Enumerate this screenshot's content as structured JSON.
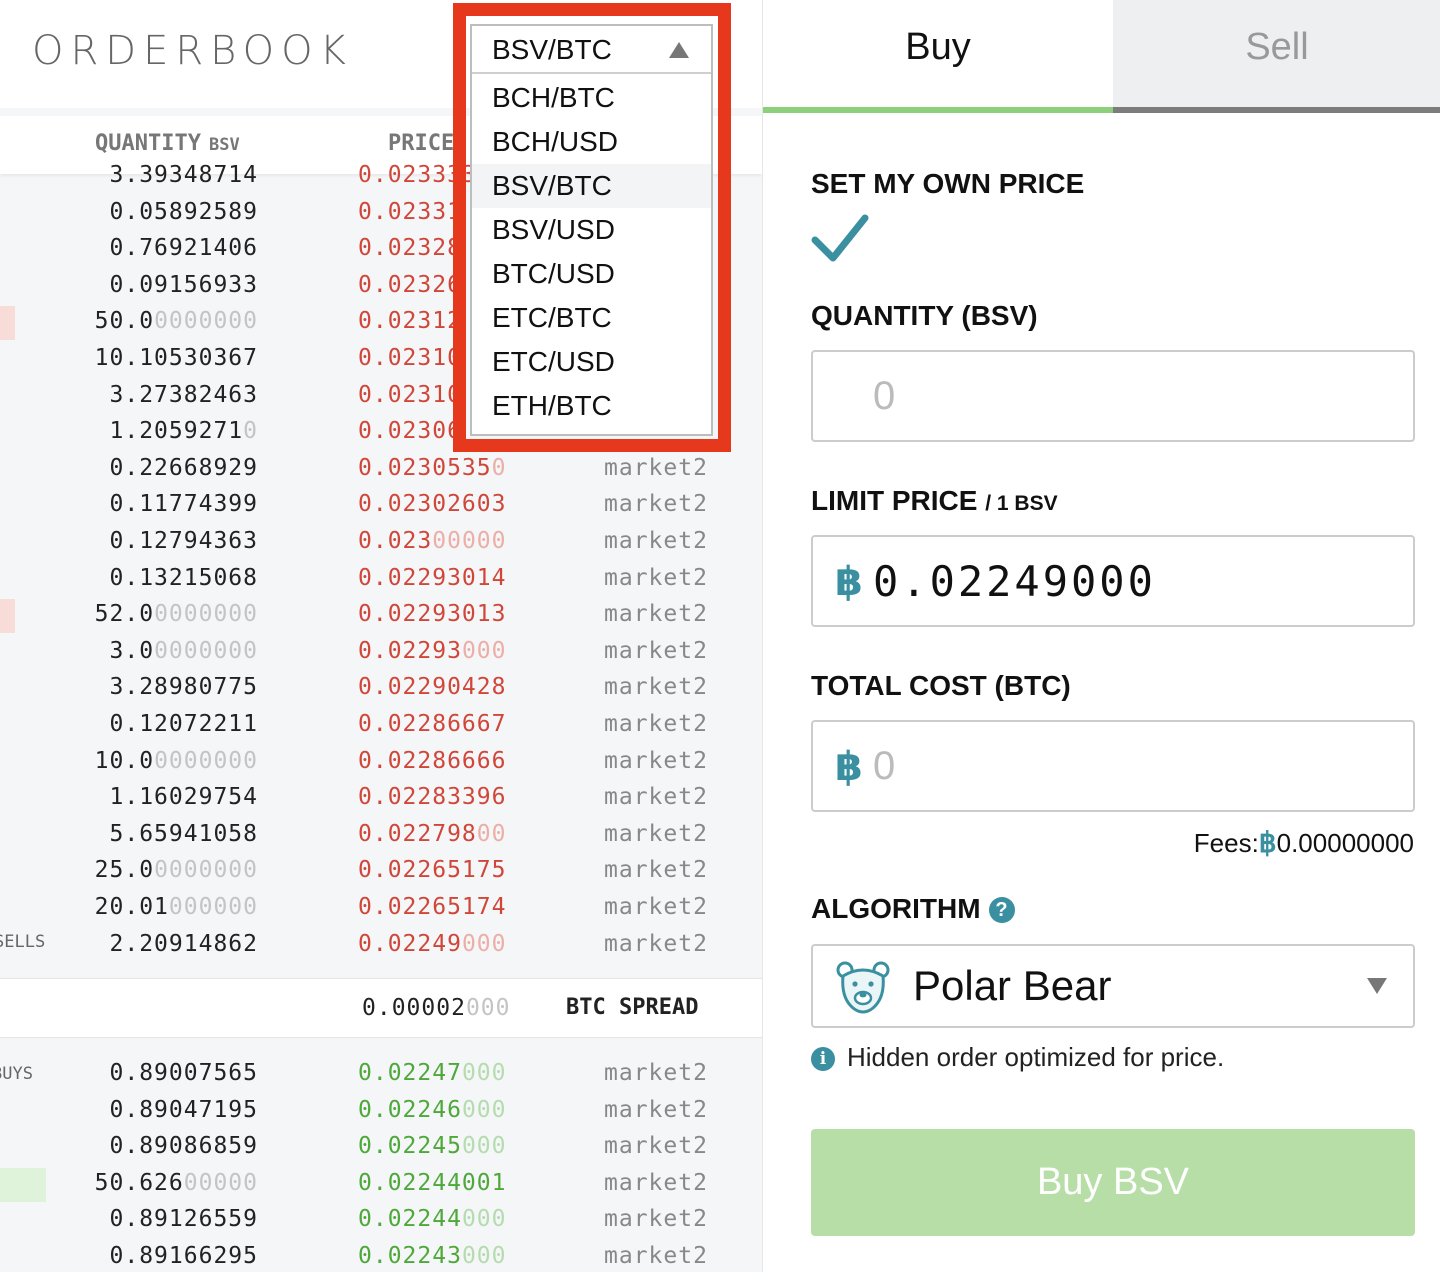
{
  "orderbook": {
    "title": "ORDERBOOK",
    "columns": {
      "quantity": "QUANTITY",
      "quantity_unit": "BSV",
      "price": "PRICE"
    },
    "sells_label": "SELLS",
    "buys_label": "BUYS",
    "sells": [
      {
        "qty_main": "3.39348714",
        "qty_dim": "",
        "price_main": "0.023333",
        "price_dim": "",
        "market": "",
        "depth": 0
      },
      {
        "qty_main": "0.05892589",
        "qty_dim": "",
        "price_main": "0.02331",
        "price_dim": "",
        "market": "",
        "depth": 0
      },
      {
        "qty_main": "0.76921406",
        "qty_dim": "",
        "price_main": "0.02328",
        "price_dim": "",
        "market": "",
        "depth": 0
      },
      {
        "qty_main": "0.09156933",
        "qty_dim": "",
        "price_main": "0.02326",
        "price_dim": "",
        "market": "",
        "depth": 0
      },
      {
        "qty_main": "50.0",
        "qty_dim": "0000000",
        "price_main": "0.02312",
        "price_dim": "",
        "market": "",
        "depth": 0.02
      },
      {
        "qty_main": "10.10530367",
        "qty_dim": "",
        "price_main": "0.02310",
        "price_dim": "",
        "market": "",
        "depth": 0
      },
      {
        "qty_main": "3.27382463",
        "qty_dim": "",
        "price_main": "0.02310",
        "price_dim": "",
        "market": "",
        "depth": 0
      },
      {
        "qty_main": "1.2059271",
        "qty_dim": "0",
        "price_main": "0.02306",
        "price_dim": "",
        "market": "",
        "depth": 0
      },
      {
        "qty_main": "0.22668929",
        "qty_dim": "",
        "price_main": "0.0230535",
        "price_dim": "0",
        "market": "market2",
        "depth": 0
      },
      {
        "qty_main": "0.11774399",
        "qty_dim": "",
        "price_main": "0.02302603",
        "price_dim": "",
        "market": "market2",
        "depth": 0
      },
      {
        "qty_main": "0.12794363",
        "qty_dim": "",
        "price_main": "0.023",
        "price_dim": "00000",
        "market": "market2",
        "depth": 0
      },
      {
        "qty_main": "0.13215068",
        "qty_dim": "",
        "price_main": "0.02293014",
        "price_dim": "",
        "market": "market2",
        "depth": 0
      },
      {
        "qty_main": "52.0",
        "qty_dim": "0000000",
        "price_main": "0.02293013",
        "price_dim": "",
        "market": "market2",
        "depth": 0.02
      },
      {
        "qty_main": "3.0",
        "qty_dim": "0000000",
        "price_main": "0.02293",
        "price_dim": "000",
        "market": "market2",
        "depth": 0
      },
      {
        "qty_main": "3.28980775",
        "qty_dim": "",
        "price_main": "0.02290428",
        "price_dim": "",
        "market": "market2",
        "depth": 0
      },
      {
        "qty_main": "0.12072211",
        "qty_dim": "",
        "price_main": "0.02286667",
        "price_dim": "",
        "market": "market2",
        "depth": 0
      },
      {
        "qty_main": "10.0",
        "qty_dim": "0000000",
        "price_main": "0.02286666",
        "price_dim": "",
        "market": "market2",
        "depth": 0
      },
      {
        "qty_main": "1.16029754",
        "qty_dim": "",
        "price_main": "0.02283396",
        "price_dim": "",
        "market": "market2",
        "depth": 0
      },
      {
        "qty_main": "5.65941058",
        "qty_dim": "",
        "price_main": "0.022798",
        "price_dim": "00",
        "market": "market2",
        "depth": 0
      },
      {
        "qty_main": "25.0",
        "qty_dim": "0000000",
        "price_main": "0.02265175",
        "price_dim": "",
        "market": "market2",
        "depth": 0
      },
      {
        "qty_main": "20.01",
        "qty_dim": "000000",
        "price_main": "0.02265174",
        "price_dim": "",
        "market": "market2",
        "depth": 0
      },
      {
        "qty_main": "2.20914862",
        "qty_dim": "",
        "price_main": "0.02249",
        "price_dim": "000",
        "market": "market2",
        "depth": 0
      }
    ],
    "spread": {
      "value_main": "0.00002",
      "value_dim": "000",
      "label": "BTC SPREAD"
    },
    "buys": [
      {
        "qty_main": "0.89007565",
        "qty_dim": "",
        "price_main": "0.02247",
        "price_dim": "000",
        "market": "market2",
        "depth": 0
      },
      {
        "qty_main": "0.89047195",
        "qty_dim": "",
        "price_main": "0.02246",
        "price_dim": "000",
        "market": "market2",
        "depth": 0
      },
      {
        "qty_main": "0.89086859",
        "qty_dim": "",
        "price_main": "0.02245",
        "price_dim": "000",
        "market": "market2",
        "depth": 0
      },
      {
        "qty_main": "50.626",
        "qty_dim": "00000",
        "price_main": "0.02244001",
        "price_dim": "",
        "market": "market2",
        "depth": 0.06
      },
      {
        "qty_main": "0.89126559",
        "qty_dim": "",
        "price_main": "0.02244",
        "price_dim": "000",
        "market": "market2",
        "depth": 0
      },
      {
        "qty_main": "0.89166295",
        "qty_dim": "",
        "price_main": "0.02243",
        "price_dim": "000",
        "market": "market2",
        "depth": 0
      }
    ]
  },
  "pair_select": {
    "current": "BSV/BTC",
    "options": [
      "BCH/BTC",
      "BCH/USD",
      "BSV/BTC",
      "BSV/USD",
      "BTC/USD",
      "ETC/BTC",
      "ETC/USD",
      "ETH/BTC"
    ],
    "active_index": 2
  },
  "trade": {
    "tabs": {
      "buy": "Buy",
      "sell": "Sell"
    },
    "set_own_price": "SET MY OWN PRICE",
    "quantity_label": "QUANTITY (BSV)",
    "quantity_placeholder": "0",
    "limit_label": "LIMIT PRICE",
    "limit_unit": "/ 1 BSV",
    "currency_symbol": "฿",
    "limit_value": "0.02249000",
    "total_label": "TOTAL COST (BTC)",
    "total_placeholder": "0",
    "fees_label": "Fees:",
    "fees_value": "0.00000000",
    "algorithm_label": "ALGORITHM",
    "help_glyph": "?",
    "algorithm_value": "Polar Bear",
    "algorithm_info": "Hidden order optimized for price.",
    "info_glyph": "i",
    "submit_label": "Buy BSV"
  },
  "colors": {
    "sell": "#d0473a",
    "buy": "#4ea83a",
    "accent": "#3a8fa0",
    "buy_button": "#b8dea8",
    "highlight": "#e5381d"
  }
}
